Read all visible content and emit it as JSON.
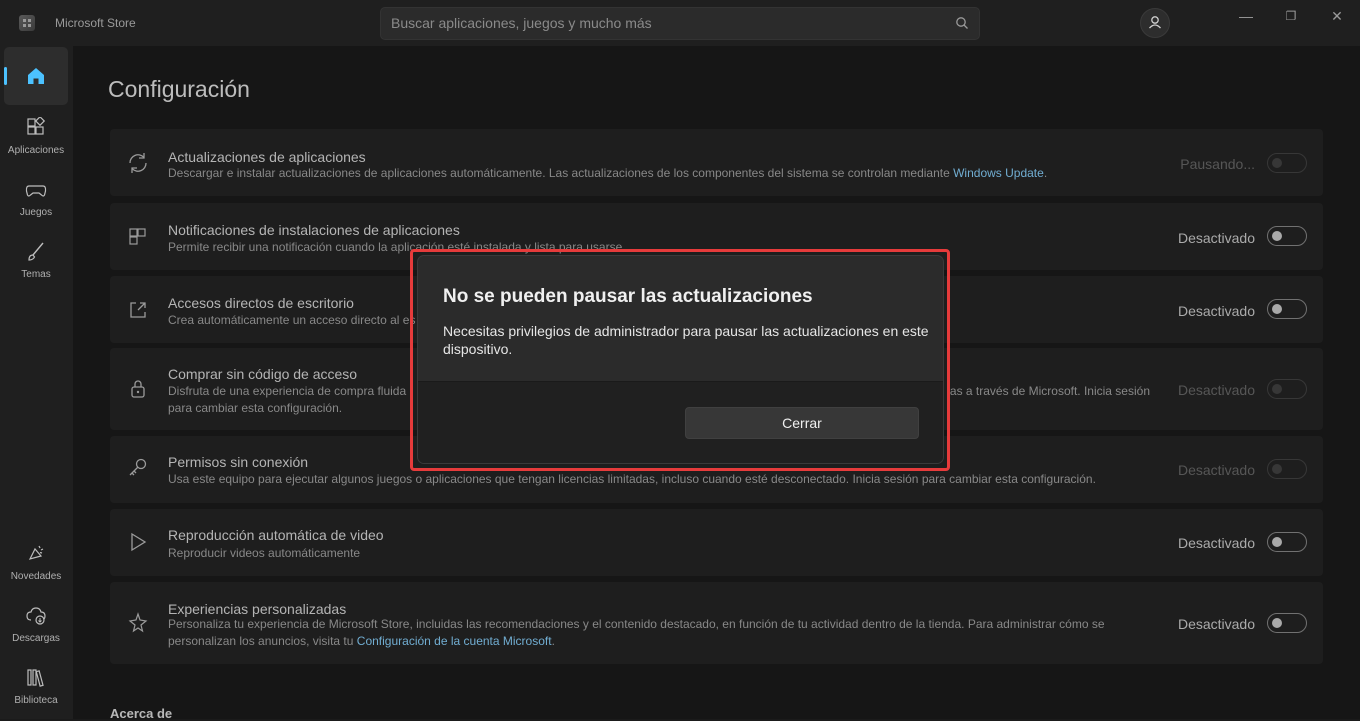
{
  "window": {
    "app_title": "Microsoft Store",
    "minimize_glyph": "—",
    "maximize_glyph": "❐",
    "close_glyph": "✕"
  },
  "search": {
    "placeholder": "Buscar aplicaciones, juegos y mucho más"
  },
  "sidebar": {
    "items": [
      {
        "label": "",
        "icon": "home-icon"
      },
      {
        "label": "Aplicaciones",
        "icon": "apps-icon"
      },
      {
        "label": "Juegos",
        "icon": "gamepad-icon"
      },
      {
        "label": "Temas",
        "icon": "brush-icon"
      },
      {
        "label": "Novedades",
        "icon": "megaphone-icon"
      },
      {
        "label": "Descargas",
        "icon": "download-icon"
      },
      {
        "label": "Biblioteca",
        "icon": "library-icon"
      }
    ]
  },
  "page": {
    "title": "Configuración",
    "section_about": "Acerca de"
  },
  "settings": [
    {
      "title": "Actualizaciones de aplicaciones",
      "desc": "Descargar e instalar actualizaciones de aplicaciones automáticamente. Las actualizaciones de los componentes del sistema se controlan mediante ",
      "link": "Windows Update",
      "desc_end": ".",
      "state": "Pausando...",
      "icon": "sync-icon"
    },
    {
      "title": "Notificaciones de instalaciones de aplicaciones",
      "desc": "Permite recibir una notificación cuando la aplicación esté instalada y lista para usarse",
      "state": "Desactivado",
      "icon": "notification-layout-icon"
    },
    {
      "title": "Accesos directos de escritorio",
      "desc": "Crea automáticamente un acceso directo al es",
      "state": "Desactivado",
      "icon": "shortcut-icon"
    },
    {
      "title": "Comprar sin código de acceso",
      "desc": "Disfruta de una experiencia de compra fluida",
      "desc_right": "as a través de Microsoft. Inicia sesión",
      "desc2": "para cambiar esta configuración.",
      "state": "Desactivado",
      "icon": "lock-icon"
    },
    {
      "title": "Permisos sin conexión",
      "desc": "Usa este equipo para ejecutar algunos juegos o aplicaciones que tengan licencias limitadas, incluso cuando esté desconectado. Inicia sesión para cambiar esta configuración.",
      "state": "Desactivado",
      "icon": "key-icon"
    },
    {
      "title": "Reproducción automática de video",
      "desc": "Reproducir videos automáticamente",
      "state": "Desactivado",
      "icon": "play-icon"
    },
    {
      "title": "Experiencias personalizadas",
      "desc": "Personaliza tu experiencia de Microsoft Store, incluidas las recomendaciones y el contenido destacado, en función de tu actividad dentro de la tienda. Para administrar cómo se personalizan los anuncios, visita tu ",
      "link": "Configuración de la cuenta Microsoft",
      "desc_end": ".",
      "state": "Desactivado",
      "icon": "sparkle-icon"
    }
  ],
  "dialog": {
    "title": "No se pueden pausar las actualizaciones",
    "body": "Necesitas privilegios de administrador para pausar las actualizaciones en este dispositivo.",
    "close_label": "Cerrar"
  },
  "colors": {
    "accent": "#4cc2ff",
    "highlight": "#e63b3b",
    "link": "#8ad3ff"
  }
}
